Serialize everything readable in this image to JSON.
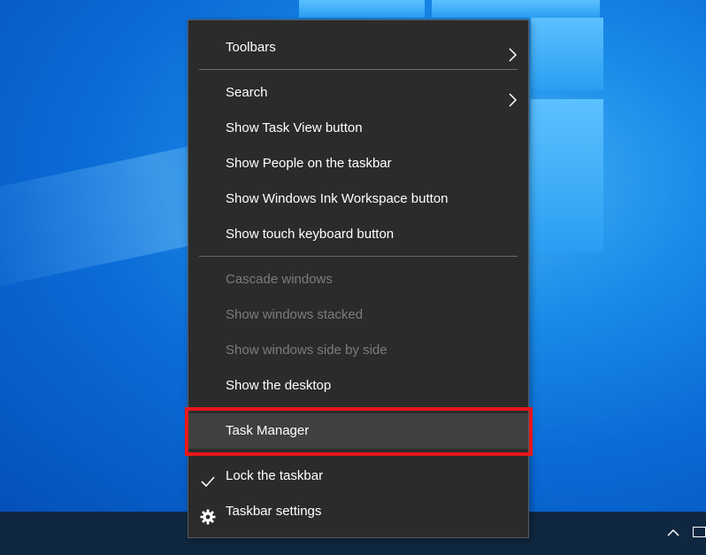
{
  "context_menu": {
    "items": [
      {
        "label": "Toolbars",
        "submenu": true
      },
      {
        "label": "Search",
        "submenu": true
      },
      {
        "label": "Show Task View button"
      },
      {
        "label": "Show People on the taskbar"
      },
      {
        "label": "Show Windows Ink Workspace button"
      },
      {
        "label": "Show touch keyboard button"
      },
      {
        "label": "Cascade windows",
        "disabled": true
      },
      {
        "label": "Show windows stacked",
        "disabled": true
      },
      {
        "label": "Show windows side by side",
        "disabled": true
      },
      {
        "label": "Show the desktop"
      },
      {
        "label": "Task Manager",
        "highlighted": true
      },
      {
        "label": "Lock the taskbar",
        "checked": true,
        "icon": "checkmark-icon"
      },
      {
        "label": "Taskbar settings",
        "icon": "gear-icon"
      }
    ]
  },
  "highlight_color": "#e8161a",
  "tray": {
    "icons": [
      "chevron-up-icon",
      "network-icon"
    ]
  }
}
